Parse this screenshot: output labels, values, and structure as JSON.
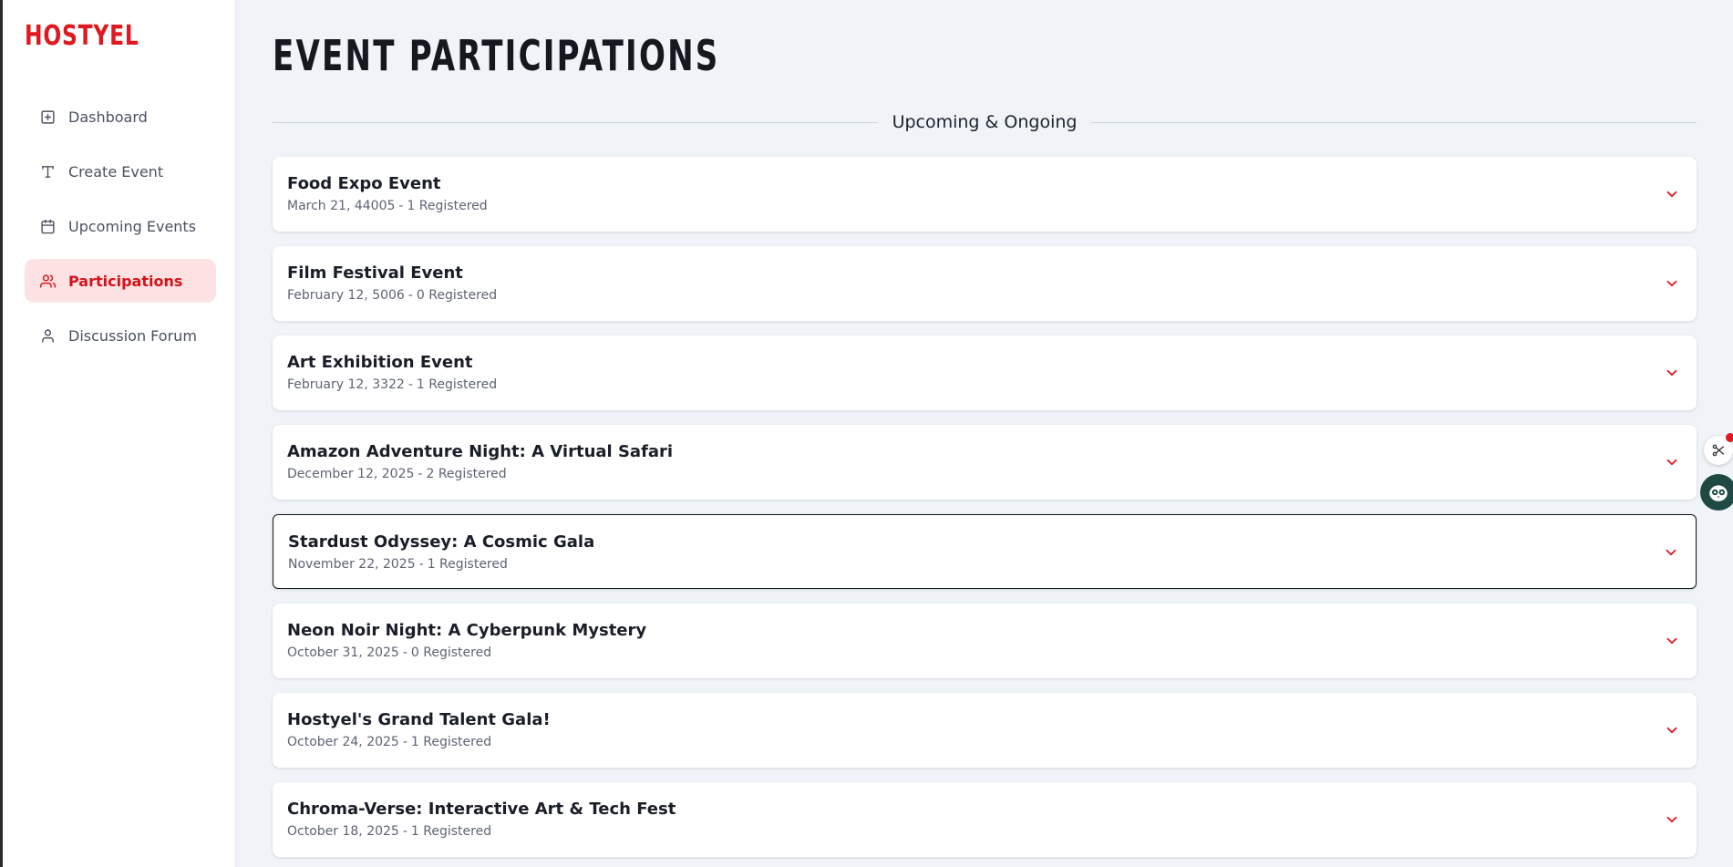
{
  "brand": {
    "logo": "HOSTYEL",
    "accent": "#e0181f"
  },
  "sidebar": {
    "items": [
      {
        "label": "Dashboard",
        "icon": "plus-square-icon",
        "active": false
      },
      {
        "label": "Create Event",
        "icon": "text-icon",
        "active": false
      },
      {
        "label": "Upcoming Events",
        "icon": "calendar-icon",
        "active": false
      },
      {
        "label": "Participations",
        "icon": "users-icon",
        "active": true
      },
      {
        "label": "Discussion Forum",
        "icon": "user-icon",
        "active": false
      }
    ]
  },
  "main": {
    "title": "EVENT PARTICIPATIONS",
    "section_label": "Upcoming & Ongoing",
    "events": [
      {
        "title": "Food Expo Event",
        "date": "March 21, 44005",
        "registered": "1 Registered"
      },
      {
        "title": "Film Festival Event",
        "date": "February 12, 5006",
        "registered": "0 Registered"
      },
      {
        "title": "Art Exhibition Event",
        "date": "February 12, 3322",
        "registered": "1 Registered"
      },
      {
        "title": "Amazon Adventure Night: A Virtual Safari",
        "date": "December 12, 2025",
        "registered": "2 Registered"
      },
      {
        "title": "Stardust Odyssey: A Cosmic Gala",
        "date": "November 22, 2025",
        "registered": "1 Registered"
      },
      {
        "title": "Neon Noir Night: A Cyberpunk Mystery",
        "date": "October 31, 2025",
        "registered": "0 Registered"
      },
      {
        "title": "Hostyel's Grand Talent Gala!",
        "date": "October 24, 2025",
        "registered": "1 Registered"
      },
      {
        "title": "Chroma-Verse: Interactive Art & Tech Fest",
        "date": "October 18, 2025",
        "registered": "1 Registered"
      }
    ],
    "separator": "-"
  },
  "widgets": {
    "share": "share-icon",
    "assistant": "owl-icon"
  }
}
